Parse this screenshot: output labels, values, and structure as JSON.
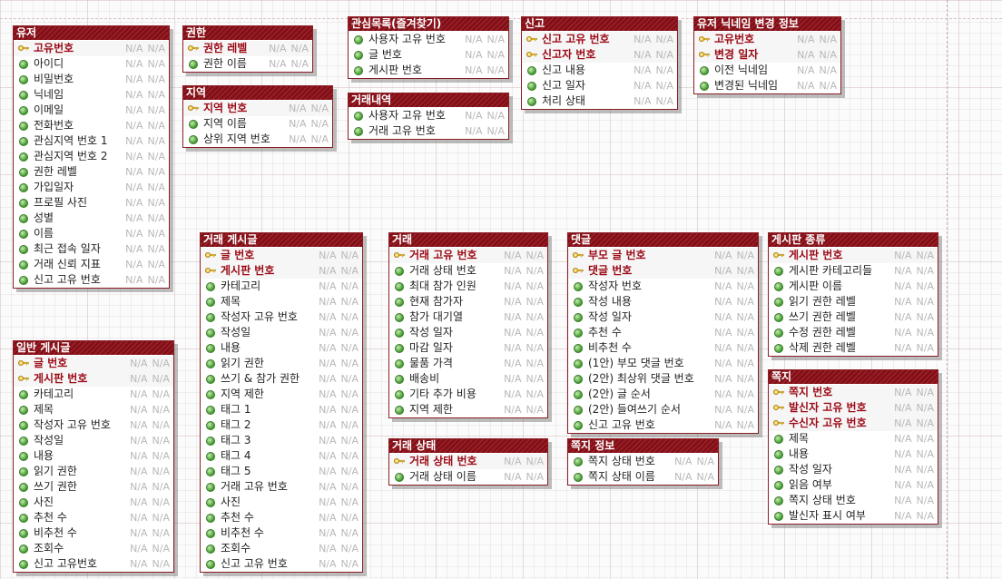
{
  "types": {
    "physical": "N/A",
    "logical": "N/A"
  },
  "entities": [
    {
      "name": "유저",
      "attrs": [
        {
          "name": "고유번호",
          "pk": true
        },
        {
          "name": "아이디"
        },
        {
          "name": "비밀번호"
        },
        {
          "name": "닉네임"
        },
        {
          "name": "이메일"
        },
        {
          "name": "전화번호"
        },
        {
          "name": "관심지역 번호 1"
        },
        {
          "name": "관심지역 번호 2"
        },
        {
          "name": "권한 레벨"
        },
        {
          "name": "가입일자"
        },
        {
          "name": "프로필 사진"
        },
        {
          "name": "성별"
        },
        {
          "name": "이름"
        },
        {
          "name": "최근 접속 일자"
        },
        {
          "name": "거래 신뢰 지표"
        },
        {
          "name": "신고 고유 번호"
        }
      ]
    },
    {
      "name": "권한",
      "attrs": [
        {
          "name": "권한 레벨",
          "pk": true
        },
        {
          "name": "권한 이름"
        }
      ]
    },
    {
      "name": "지역",
      "attrs": [
        {
          "name": "지역 번호",
          "pk": true
        },
        {
          "name": "지역 이름"
        },
        {
          "name": "상위 지역 번호"
        }
      ]
    },
    {
      "name": "관심목록(즐겨찾기)",
      "attrs": [
        {
          "name": "사용자 고유 번호"
        },
        {
          "name": "글 번호"
        },
        {
          "name": "게시판 번호"
        }
      ]
    },
    {
      "name": "거래내역",
      "attrs": [
        {
          "name": "사용자 고유 번호"
        },
        {
          "name": "거래 고유 번호"
        }
      ]
    },
    {
      "name": "신고",
      "attrs": [
        {
          "name": "신고 고유 번호",
          "pk": true
        },
        {
          "name": "신고자 번호",
          "pk": true
        },
        {
          "name": "신고 내용"
        },
        {
          "name": "신고 일자"
        },
        {
          "name": "처리 상태"
        }
      ]
    },
    {
      "name": "유저 닉네임 변경 정보",
      "attrs": [
        {
          "name": "고유번호",
          "pk": true
        },
        {
          "name": "변경 일자",
          "pk": true
        },
        {
          "name": "이전 닉네임"
        },
        {
          "name": "변경된 닉네임"
        }
      ]
    },
    {
      "name": "거래 게시글",
      "attrs": [
        {
          "name": "글 번호",
          "pk": true
        },
        {
          "name": "게시판 번호",
          "pk": true
        },
        {
          "name": "카테고리"
        },
        {
          "name": "제목"
        },
        {
          "name": "작성자 고유 번호"
        },
        {
          "name": "작성일"
        },
        {
          "name": "내용"
        },
        {
          "name": "읽기 권한"
        },
        {
          "name": "쓰기 & 참가 권한"
        },
        {
          "name": "지역 제한"
        },
        {
          "name": "태그 1"
        },
        {
          "name": "태그 2"
        },
        {
          "name": "태그 3"
        },
        {
          "name": "태그 4"
        },
        {
          "name": "태그 5"
        },
        {
          "name": "거래 고유 번호"
        },
        {
          "name": "사진"
        },
        {
          "name": "추천 수"
        },
        {
          "name": "비추천 수"
        },
        {
          "name": "조회수"
        },
        {
          "name": "신고 고유 번호"
        }
      ]
    },
    {
      "name": "거래",
      "attrs": [
        {
          "name": "거래 고유 번호",
          "pk": true
        },
        {
          "name": "거래 상태 번호"
        },
        {
          "name": "최대 참가 인원"
        },
        {
          "name": "현재 참가자"
        },
        {
          "name": "참가 대기열"
        },
        {
          "name": "작성 일자"
        },
        {
          "name": "마감 일자"
        },
        {
          "name": "물품 가격"
        },
        {
          "name": "배송비"
        },
        {
          "name": "기타 추가 비용"
        },
        {
          "name": "지역 제한"
        }
      ]
    },
    {
      "name": "거래 상태",
      "attrs": [
        {
          "name": "거래 상태 번호",
          "pk": true
        },
        {
          "name": "거래 상태 이름"
        }
      ]
    },
    {
      "name": "댓글",
      "attrs": [
        {
          "name": "부모 글 번호",
          "pk": true
        },
        {
          "name": "댓글 번호",
          "pk": true
        },
        {
          "name": "작성자 번호"
        },
        {
          "name": "작성 내용"
        },
        {
          "name": "작성 일자"
        },
        {
          "name": "추천 수"
        },
        {
          "name": "비추천 수"
        },
        {
          "name": "(1안) 부모 댓글 번호"
        },
        {
          "name": "(2안) 최상위 댓글 번호"
        },
        {
          "name": "(2안) 글 순서"
        },
        {
          "name": "(2안) 들여쓰기 순서"
        },
        {
          "name": "신고 고유 번호"
        }
      ]
    },
    {
      "name": "쪽지 정보",
      "attrs": [
        {
          "name": "쪽지 상태 번호"
        },
        {
          "name": "쪽지 상태 이름"
        }
      ]
    },
    {
      "name": "게시판 종류",
      "attrs": [
        {
          "name": "게시판 번호",
          "pk": true
        },
        {
          "name": "게시판 카테고리들"
        },
        {
          "name": "게시판 이름"
        },
        {
          "name": "읽기 권한 레벨"
        },
        {
          "name": "쓰기 권한 레벨"
        },
        {
          "name": "수정 권한 레벨"
        },
        {
          "name": "삭제 권한 레벨"
        }
      ]
    },
    {
      "name": "쪽지",
      "attrs": [
        {
          "name": "쪽지 번호",
          "pk": true
        },
        {
          "name": "발신자 고유 번호",
          "pk": true
        },
        {
          "name": "수신자 고유 번호",
          "pk": true
        },
        {
          "name": "제목"
        },
        {
          "name": "내용"
        },
        {
          "name": "작성 일자"
        },
        {
          "name": "읽음 여부"
        },
        {
          "name": "쪽지 상태 번호"
        },
        {
          "name": "발신자 표시 여부"
        }
      ]
    },
    {
      "name": "일반 게시글",
      "attrs": [
        {
          "name": "글 번호",
          "pk": true
        },
        {
          "name": "게시판 번호",
          "pk": true
        },
        {
          "name": "카테고리"
        },
        {
          "name": "제목"
        },
        {
          "name": "작성자 고유 번호"
        },
        {
          "name": "작성일"
        },
        {
          "name": "내용"
        },
        {
          "name": "읽기 권한"
        },
        {
          "name": "쓰기 권한"
        },
        {
          "name": "사진"
        },
        {
          "name": "추천 수"
        },
        {
          "name": "비추천 수"
        },
        {
          "name": "조회수"
        },
        {
          "name": "신고 고유번호"
        }
      ]
    }
  ]
}
